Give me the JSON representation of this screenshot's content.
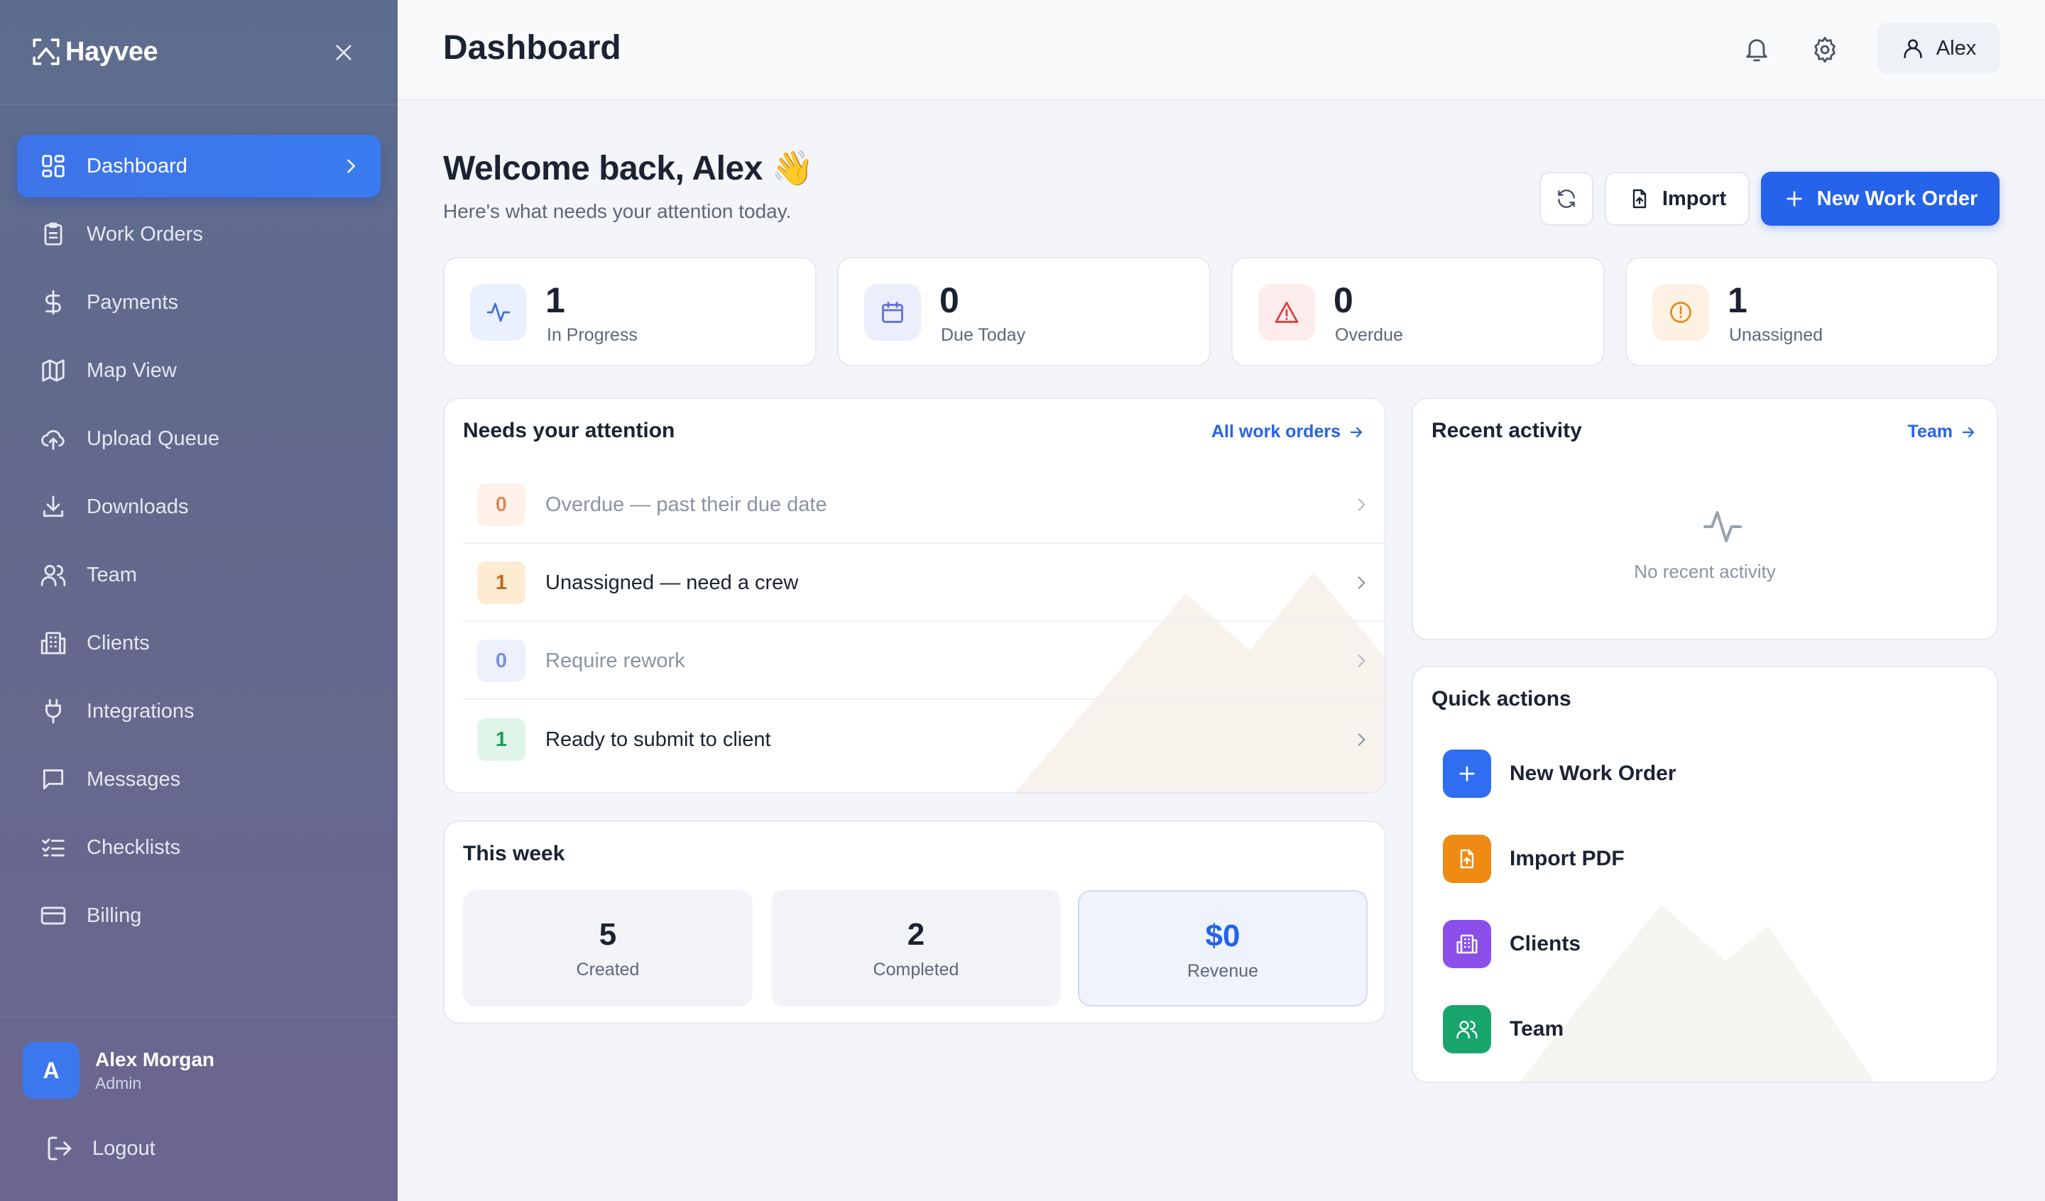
{
  "brand": {
    "name": "Hayvee"
  },
  "sidebar": {
    "items": [
      {
        "label": "Dashboard",
        "icon": "dashboard-icon",
        "active": true
      },
      {
        "label": "Work Orders",
        "icon": "clipboard-icon"
      },
      {
        "label": "Payments",
        "icon": "dollar-icon"
      },
      {
        "label": "Map View",
        "icon": "map-icon"
      },
      {
        "label": "Upload Queue",
        "icon": "cloud-upload-icon"
      },
      {
        "label": "Downloads",
        "icon": "download-icon"
      },
      {
        "label": "Team",
        "icon": "users-icon"
      },
      {
        "label": "Clients",
        "icon": "building-icon"
      },
      {
        "label": "Integrations",
        "icon": "plug-icon"
      },
      {
        "label": "Messages",
        "icon": "message-icon"
      },
      {
        "label": "Checklists",
        "icon": "checklist-icon"
      },
      {
        "label": "Billing",
        "icon": "credit-card-icon"
      }
    ],
    "user": {
      "initial": "A",
      "name": "Alex Morgan",
      "role": "Admin"
    },
    "logout_label": "Logout"
  },
  "header": {
    "title": "Dashboard",
    "user_label": "Alex"
  },
  "main": {
    "welcome": "Welcome back, Alex",
    "wave_emoji": "👋",
    "subtitle": "Here's what needs your attention today.",
    "actions": {
      "import_label": "Import",
      "new_label": "New Work Order"
    },
    "stats": [
      {
        "value": "1",
        "label": "In Progress",
        "color": "#3b6fd8",
        "bg": "#eaf0fd"
      },
      {
        "value": "0",
        "label": "Due Today",
        "color": "#5b6fd9",
        "bg": "#eceefc"
      },
      {
        "value": "0",
        "label": "Overdue",
        "color": "#dc3b3b",
        "bg": "#fdecec"
      },
      {
        "value": "1",
        "label": "Unassigned",
        "color": "#e08a1e",
        "bg": "#fdf1e3"
      }
    ],
    "attention": {
      "title": "Needs your attention",
      "link": "All work orders",
      "rows": [
        {
          "count": "0",
          "text": "Overdue — past their due date",
          "muted": true,
          "badge_color": "#e08a5a",
          "badge_bg": "#fdf1ea"
        },
        {
          "count": "1",
          "text": "Unassigned — need a crew",
          "muted": false,
          "badge_color": "#c0661a",
          "badge_bg": "#fdebd2"
        },
        {
          "count": "0",
          "text": "Require rework",
          "muted": true,
          "badge_color": "#7a8fd8",
          "badge_bg": "#eef1fc"
        },
        {
          "count": "1",
          "text": "Ready to submit to client",
          "muted": false,
          "badge_color": "#1c9a5a",
          "badge_bg": "#dff5e9"
        }
      ]
    },
    "week": {
      "title": "This week",
      "items": [
        {
          "value": "5",
          "label": "Created"
        },
        {
          "value": "2",
          "label": "Completed"
        },
        {
          "value": "$0",
          "label": "Revenue"
        }
      ]
    },
    "activity": {
      "title": "Recent activity",
      "link": "Team",
      "empty": "No recent activity"
    },
    "quick_actions": {
      "title": "Quick actions",
      "items": [
        {
          "label": "New Work Order",
          "color": "#2f6ef0"
        },
        {
          "label": "Import PDF",
          "color": "#ef8a12"
        },
        {
          "label": "Clients",
          "color": "#8a4fea"
        },
        {
          "label": "Team",
          "color": "#17a56b"
        }
      ]
    }
  }
}
